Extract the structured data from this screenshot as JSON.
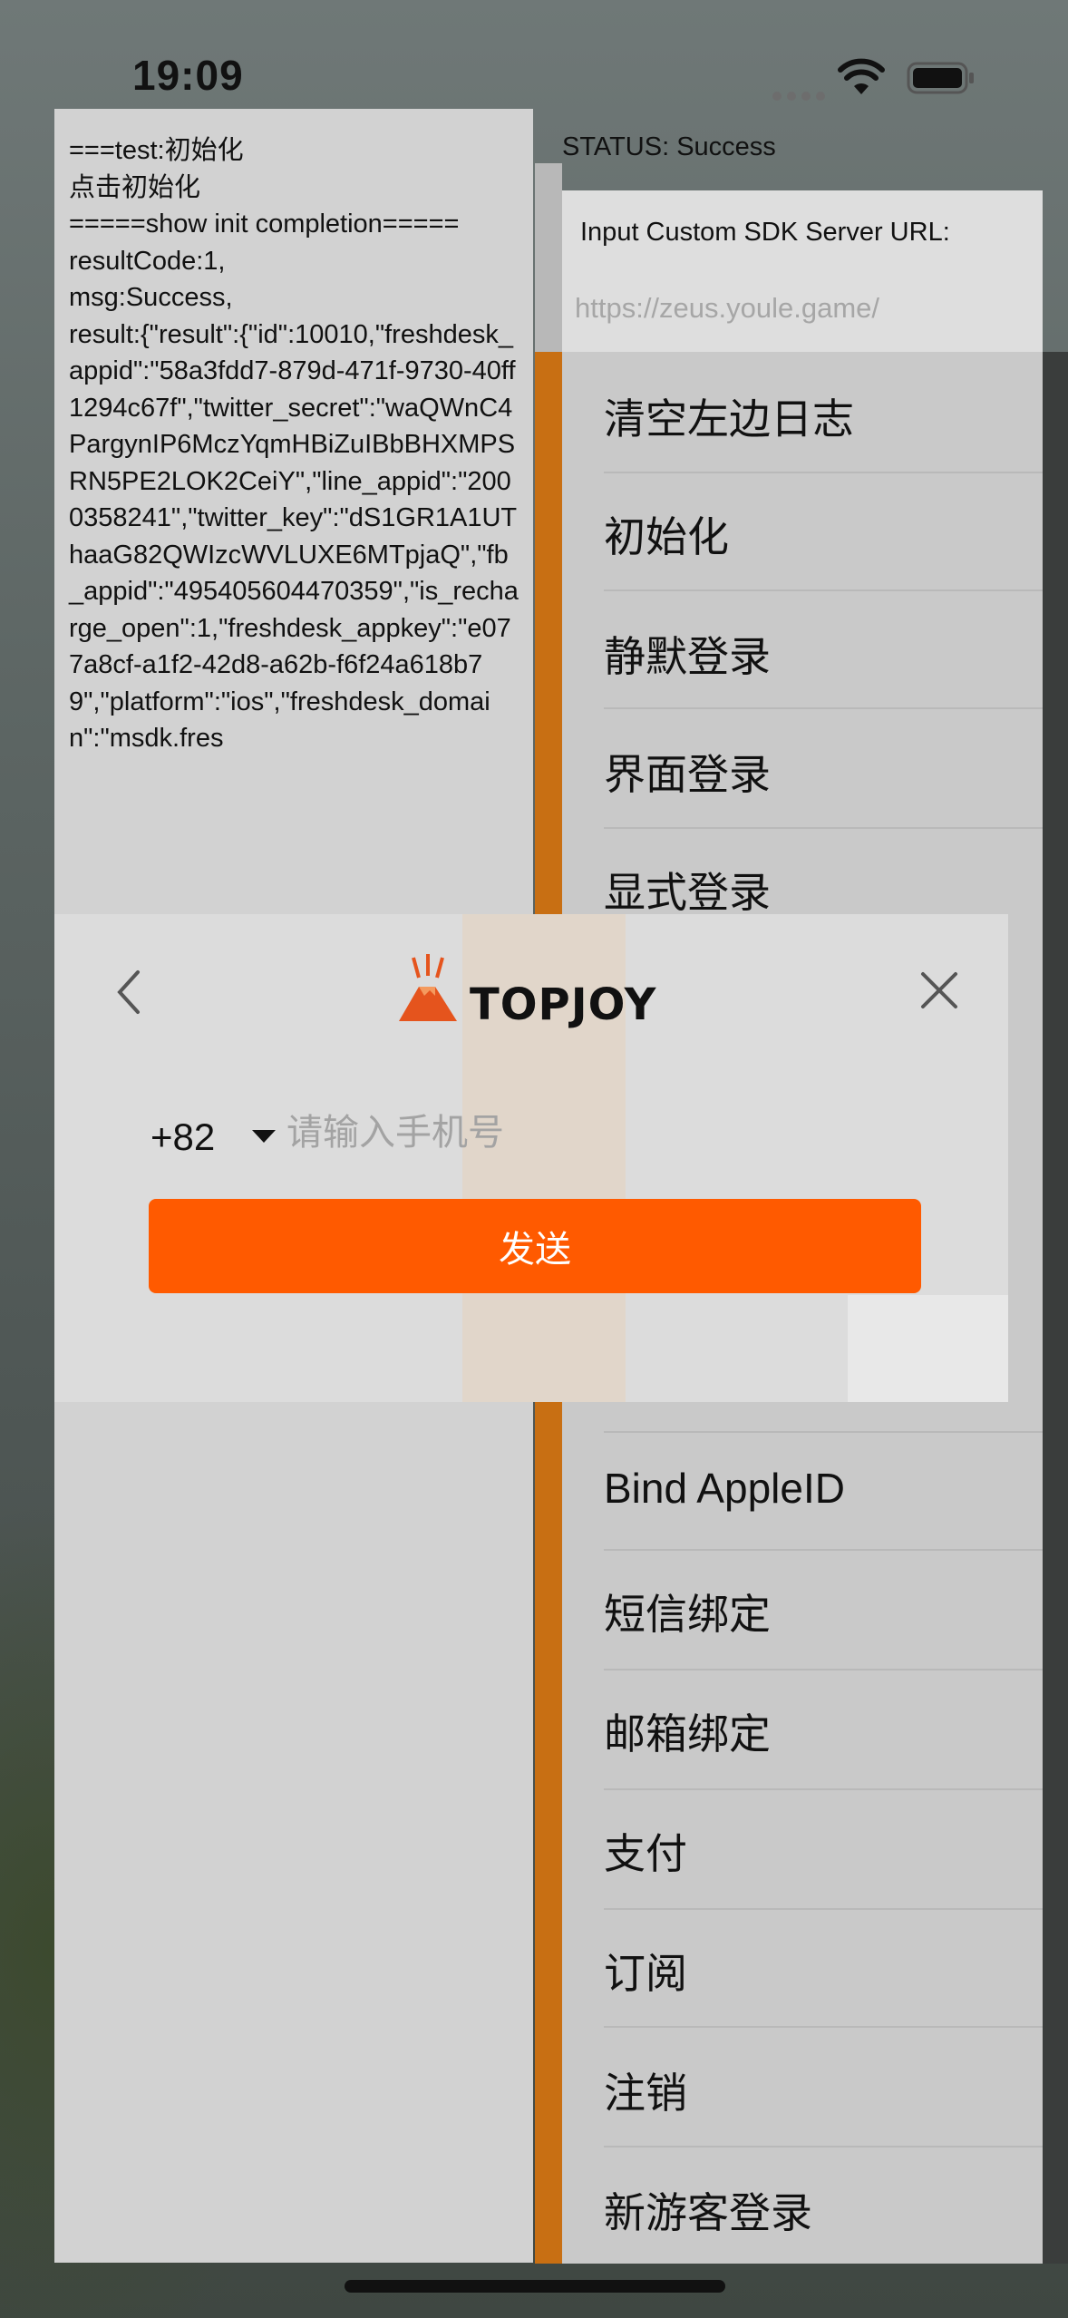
{
  "status_bar": {
    "time": "19:09"
  },
  "log": {
    "text": "===test:初始化\n点击初始化\n=====show init completion=====\nresultCode:1,\nmsg:Success,\nresult:{\"result\":{\"id\":10010,\"freshdesk_appid\":\"58a3fdd7-879d-471f-9730-40ff1294c67f\",\"twitter_secret\":\"waQWnC4PargynIP6MczYqmHBiZuIBbBHXMPSRN5PE2LOK2CeiY\",\"line_appid\":\"2000358241\",\"twitter_key\":\"dS1GR1A1UThaaG82QWIzcWVLUXE6MTpjaQ\",\"fb_appid\":\"495405604470359\",\"is_recharge_open\":1,\"freshdesk_appkey\":\"e077a8cf-a1f2-42d8-a62b-f6f24a618b79\",\"platform\":\"ios\",\"freshdesk_domain\":\"msdk.fres"
  },
  "status": "STATUS: Success",
  "server_url": {
    "label": "Input Custom SDK Server URL:",
    "placeholder": "https://zeus.youle.game/"
  },
  "menu": {
    "items": [
      "清空左边日志",
      "初始化",
      "静默登录",
      "界面登录",
      "显式登录",
      "Bind AppleID",
      "短信绑定",
      "邮箱绑定",
      "支付",
      "订阅",
      "注销",
      "新游客登录"
    ]
  },
  "popup": {
    "brand": "TOPJOY",
    "country_code": "+82",
    "phone_placeholder": "请输入手机号",
    "send_label": "发送"
  },
  "colors": {
    "accent_orange": "#ff5a00",
    "strip_orange": "#c86f13"
  }
}
